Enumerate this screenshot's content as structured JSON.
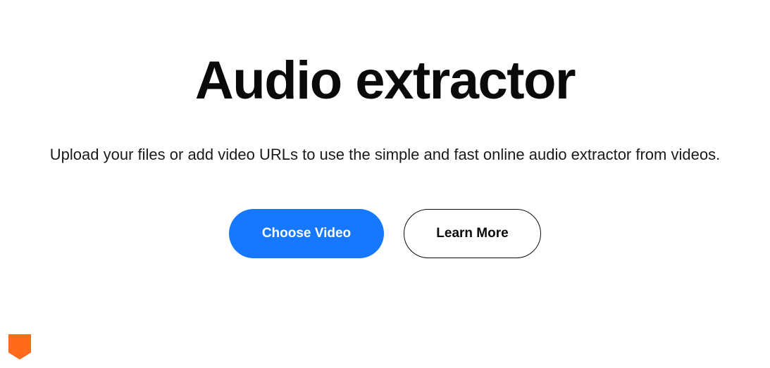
{
  "hero": {
    "title": "Audio extractor",
    "subtitle": "Upload your files or add video URLs to use the simple and fast online audio extractor from videos.",
    "primary_button_label": "Choose Video",
    "secondary_button_label": "Learn More"
  },
  "badge": {
    "color": "#ff6b1a"
  }
}
